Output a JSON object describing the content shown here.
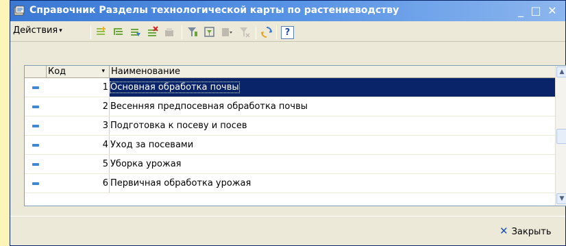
{
  "window": {
    "title": "Справочник Разделы технологической карты по растениеводству",
    "minimize_glyph": "_",
    "maximize_glyph": "□",
    "close_glyph": "✕"
  },
  "toolbar": {
    "actions_label": "Действия",
    "actions_caret": "▾",
    "icons": [
      "add-item-icon",
      "add-group-icon",
      "copy-item-icon",
      "edit-item-icon",
      "save-disabled-icon",
      "filter-icon",
      "filter-settings-icon",
      "filter-dropdown-icon",
      "clear-filter-icon",
      "refresh-icon",
      "help-icon"
    ],
    "help_glyph": "?"
  },
  "table": {
    "columns": {
      "code": "Код",
      "name": "Наименование"
    },
    "sort_glyph": "▾",
    "rows": [
      {
        "code": "1",
        "name": "Основная обработка почвы",
        "selected": true
      },
      {
        "code": "2",
        "name": "Весенняя предпосевная обработка почвы",
        "selected": false
      },
      {
        "code": "3",
        "name": "Подготовка к посеву и посев",
        "selected": false
      },
      {
        "code": "4",
        "name": "Уход за посевами",
        "selected": false
      },
      {
        "code": "5",
        "name": "Уборка урожая",
        "selected": false
      },
      {
        "code": "6",
        "name": "Первичная обработка урожая",
        "selected": false
      }
    ],
    "scroll_up_glyph": "▲",
    "scroll_down_glyph": "▼"
  },
  "footer": {
    "close_icon": "✕",
    "close_label": "Закрыть"
  },
  "colors": {
    "titlebar": "#3a78d4",
    "selection": "#0a246a",
    "row_marker": "#3c88d4",
    "background": "#fdf5b7"
  }
}
